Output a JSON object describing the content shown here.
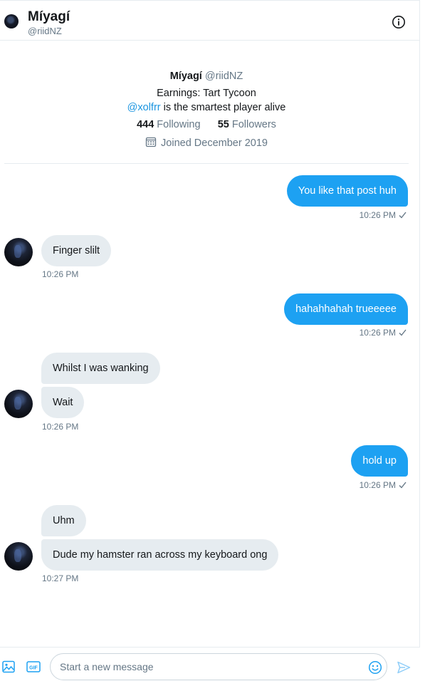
{
  "header": {
    "name": "Míyagí",
    "handle": "@riidNZ",
    "info_icon": "info-icon"
  },
  "profile": {
    "name": "Míyagí",
    "handle": "@riidNZ",
    "bio_line1": "Earnings: Tart Tycoon",
    "bio_mention": "@xolfrr",
    "bio_line2_rest": " is the smartest player alive",
    "following_count": "444",
    "following_label": "Following",
    "followers_count": "55",
    "followers_label": "Followers",
    "joined": "Joined December 2019",
    "calendar_icon": "calendar-icon"
  },
  "messages": [
    {
      "dir": "out",
      "text": "You like that post huh",
      "time": "10:26 PM"
    },
    {
      "dir": "in",
      "text": "Finger slilt",
      "time": "10:26 PM"
    },
    {
      "dir": "out",
      "text": "hahahhahah trueeeee",
      "time": "10:26 PM"
    },
    {
      "dir": "in",
      "text": "Whilst I was wanking"
    },
    {
      "dir": "in",
      "text": "Wait",
      "time": "10:26 PM"
    },
    {
      "dir": "out",
      "text": "hold up",
      "time": "10:26 PM"
    },
    {
      "dir": "in",
      "text": "Uhm"
    },
    {
      "dir": "in",
      "text": "Dude my hamster ran across my keyboard ong",
      "time": "10:27 PM"
    }
  ],
  "composer": {
    "placeholder": "Start a new message",
    "value": "",
    "media_icon": "image-icon",
    "gif_icon": "gif-icon",
    "gif_label": "GIF",
    "emoji_icon": "emoji-icon",
    "send_icon": "send-icon"
  },
  "colors": {
    "accent": "#1da1f2",
    "link": "#1b95e0",
    "bubble_in": "#e6ecf0",
    "muted": "#657786"
  }
}
